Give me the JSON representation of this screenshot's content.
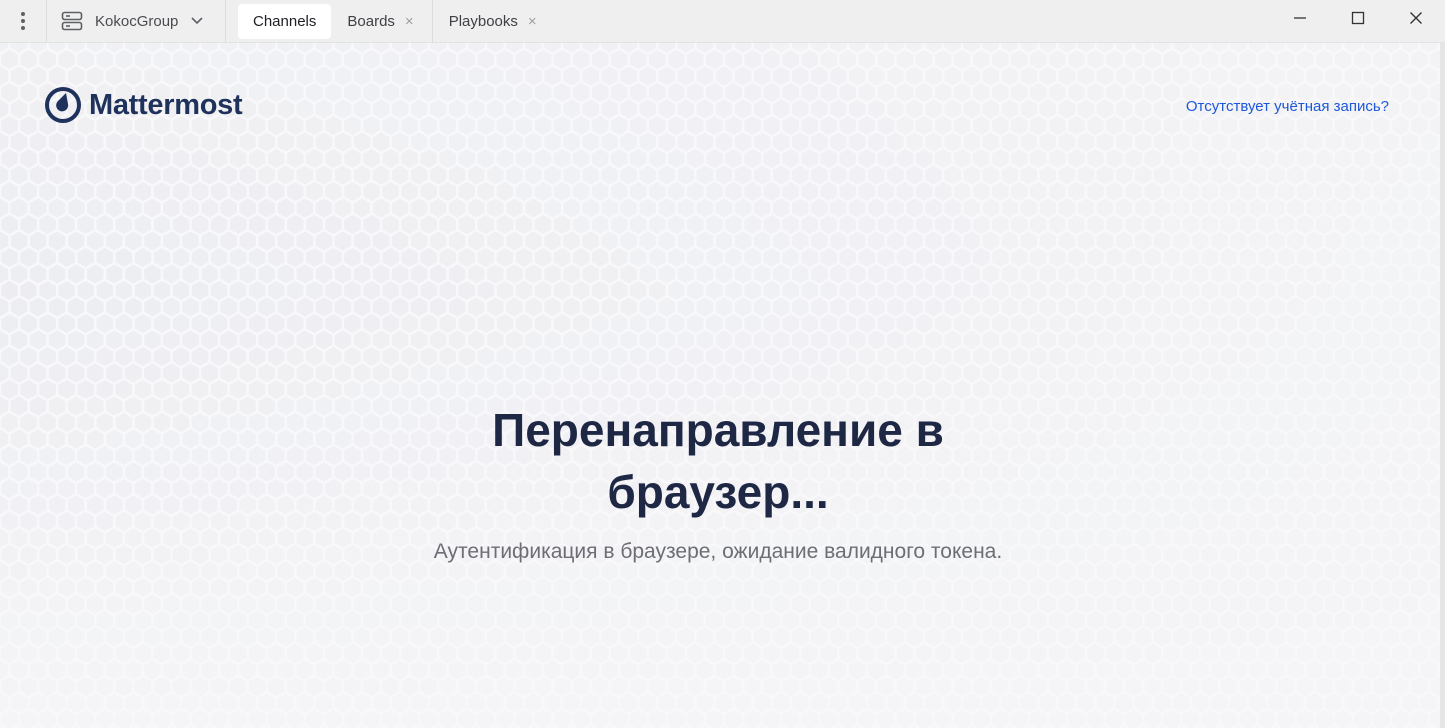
{
  "titlebar": {
    "server_name": "KokocGroup",
    "tabs": [
      {
        "label": "Channels",
        "active": true,
        "closable": false
      },
      {
        "label": "Boards",
        "active": false,
        "closable": true
      },
      {
        "label": "Playbooks",
        "active": false,
        "closable": true
      }
    ],
    "close_glyph": "×",
    "icons": {
      "menu": "three-dots-vertical-icon",
      "server": "server-icon",
      "dropdown": "chevron-down-icon",
      "minimize": "minimize-icon",
      "maximize": "maximize-icon",
      "close": "close-icon"
    }
  },
  "page": {
    "logo_text": "Mattermost",
    "signup_link": "Отсутствует учётная запись?",
    "headline": "Перенаправление в браузер...",
    "subtext": "Аутентификация в браузере, ожидание валидного токена."
  },
  "colors": {
    "brand": "#1e325c",
    "link": "#1c58d9",
    "headline": "#1e2744",
    "subtext": "#6d6e75",
    "titlebar_bg": "#efeff0",
    "content_bg": "#f8f8fa"
  }
}
